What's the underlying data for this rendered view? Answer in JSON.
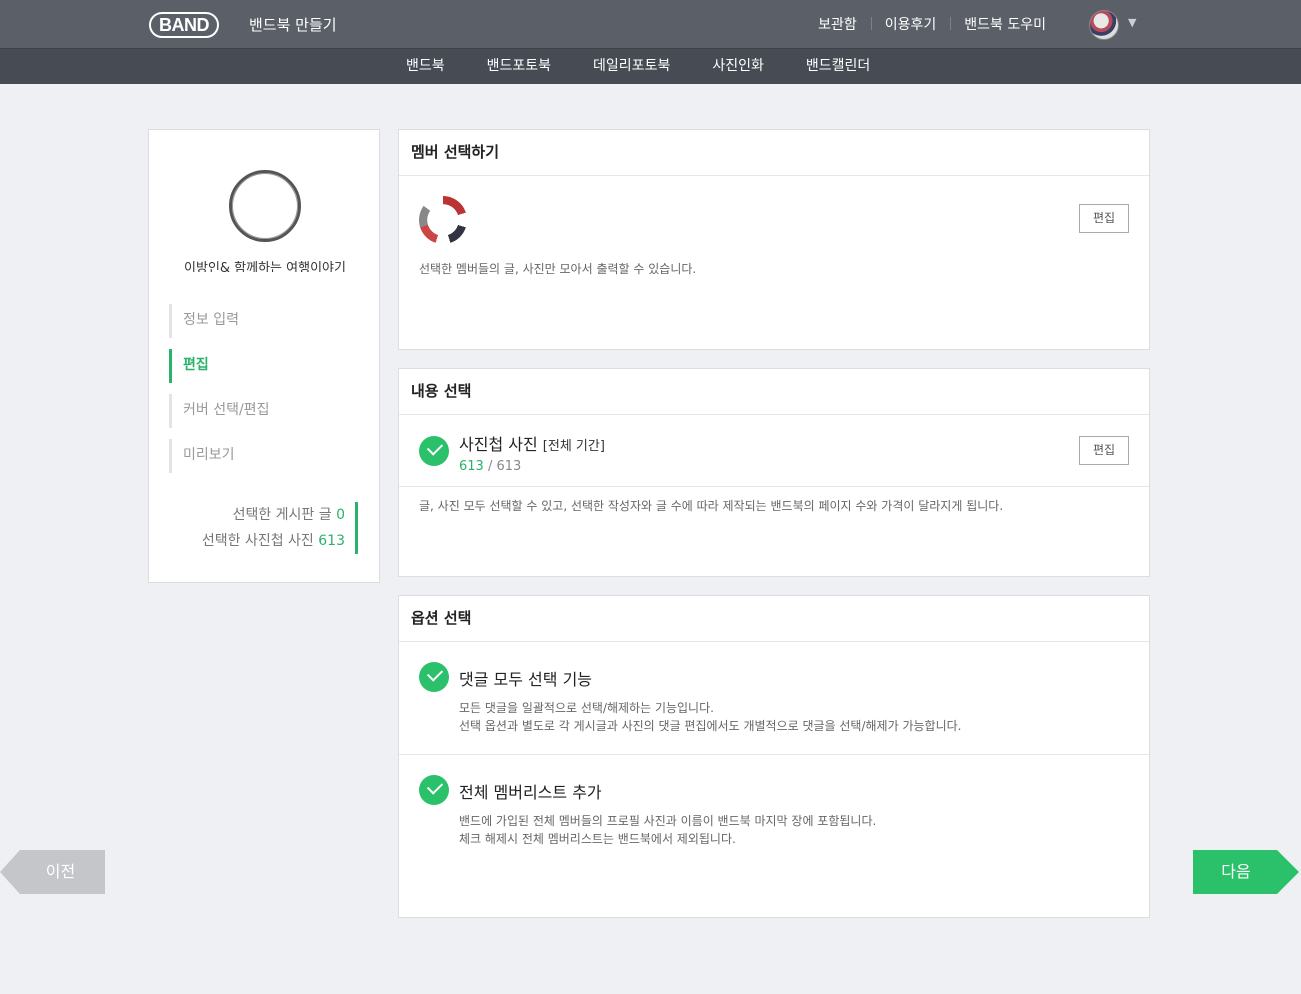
{
  "header": {
    "logo": "BAND",
    "title": "밴드북 만들기",
    "links": [
      "보관함",
      "이용후기",
      "밴드북 도우미"
    ]
  },
  "subnav": [
    "밴드북",
    "밴드포토북",
    "데일리포토북",
    "사진인화",
    "밴드캘린더"
  ],
  "sidebar": {
    "band_name": "이방인& 함께하는 여행이야기",
    "steps": [
      {
        "label": "정보 입력",
        "active": false
      },
      {
        "label": "편집",
        "active": true
      },
      {
        "label": "커버 선택/편집",
        "active": false
      },
      {
        "label": "미리보기",
        "active": false
      }
    ],
    "summary": {
      "posts_label": "선택한 게시판 글",
      "posts_count": "0",
      "photos_label": "선택한 사진첩 사진",
      "photos_count": "613"
    }
  },
  "member_card": {
    "title": "멤버 선택하기",
    "edit_label": "편집",
    "description": "선택한 멤버들의 글, 사진만 모아서 출력할 수 있습니다."
  },
  "content_card": {
    "title": "내용 선택",
    "item_title": "사진첩 사진",
    "item_period": "[전체 기간]",
    "selected": "613",
    "total": "/ 613",
    "edit_label": "편집",
    "description": "글, 사진 모두 선택할 수 있고, 선택한 작성자와 글 수에 따라 제작되는 밴드북의 페이지 수와 가격이 달라지게 됩니다."
  },
  "option_card": {
    "title": "옵션 선택",
    "options": [
      {
        "title": "댓글 모두 선택 기능",
        "line1": "모든 댓글을 일괄적으로 선택/해제하는 기능입니다.",
        "line2": "선택 옵션과 별도로 각 게시글과 사진의 댓글 편집에서도 개별적으로 댓글을 선택/해제가 가능합니다."
      },
      {
        "title": "전체 멤버리스트 추가",
        "line1": "밴드에 가입된 전체 멤버들의 프로필 사진과 이름이 밴드북 마지막 장에 포함됩니다.",
        "line2": "체크 해제시 전체 멤버리스트는 밴드북에서 제외됩니다."
      }
    ]
  },
  "nav": {
    "prev": "이전",
    "next": "다음"
  },
  "colors": {
    "accent": "#2bc16b",
    "header": "#5b6068",
    "subnav": "#474c54"
  }
}
